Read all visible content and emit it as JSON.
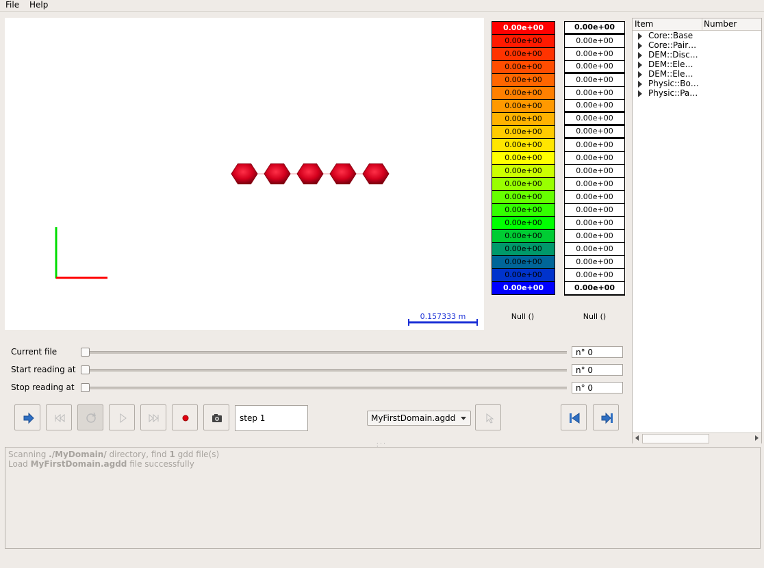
{
  "menubar": {
    "file": "File",
    "help": "Help"
  },
  "viewport": {
    "scale_label": "0.157333 m",
    "particle_color": "#d4001d",
    "axis_x_color": "#ff0000",
    "axis_y_color": "#00dd00",
    "scale_bar_color": "#1a2fd6"
  },
  "color_scale_left": {
    "cells": [
      {
        "label": "0.00e+00",
        "color": "#ff0000"
      },
      {
        "label": "0.00e+00",
        "color": "#ff1a00"
      },
      {
        "label": "0.00e+00",
        "color": "#ff3300"
      },
      {
        "label": "0.00e+00",
        "color": "#ff4d00"
      },
      {
        "label": "0.00e+00",
        "color": "#ff6600"
      },
      {
        "label": "0.00e+00",
        "color": "#ff8000"
      },
      {
        "label": "0.00e+00",
        "color": "#ff9900"
      },
      {
        "label": "0.00e+00",
        "color": "#ffb300"
      },
      {
        "label": "0.00e+00",
        "color": "#ffcc00"
      },
      {
        "label": "0.00e+00",
        "color": "#ffe600"
      },
      {
        "label": "0.00e+00",
        "color": "#ffff00"
      },
      {
        "label": "0.00e+00",
        "color": "#ccff00"
      },
      {
        "label": "0.00e+00",
        "color": "#99ff00"
      },
      {
        "label": "0.00e+00",
        "color": "#66ff00"
      },
      {
        "label": "0.00e+00",
        "color": "#33ff00"
      },
      {
        "label": "0.00e+00",
        "color": "#00ff00"
      },
      {
        "label": "0.00e+00",
        "color": "#00cc33"
      },
      {
        "label": "0.00e+00",
        "color": "#00996a"
      },
      {
        "label": "0.00e+00",
        "color": "#006699"
      },
      {
        "label": "0.00e+00",
        "color": "#0033cc"
      },
      {
        "label": "0.00e+00",
        "color": "#0000ff"
      }
    ],
    "footer": "Null ()"
  },
  "color_scale_right": {
    "cells": [
      "0.00e+00",
      "0.00e+00",
      "0.00e+00",
      "0.00e+00",
      "0.00e+00",
      "0.00e+00",
      "0.00e+00",
      "0.00e+00",
      "0.00e+00",
      "0.00e+00",
      "0.00e+00",
      "0.00e+00",
      "0.00e+00",
      "0.00e+00",
      "0.00e+00",
      "0.00e+00",
      "0.00e+00",
      "0.00e+00",
      "0.00e+00",
      "0.00e+00",
      "0.00e+00"
    ],
    "footer": "Null ()"
  },
  "tree": {
    "columns": [
      "Item",
      "Number"
    ],
    "items": [
      "Core::Base",
      "Core::Pair…",
      "DEM::Disc…",
      "DEM::Ele…",
      "DEM::Ele…",
      "Physic::Bo…",
      "Physic::Pa…"
    ]
  },
  "sliders": {
    "current_file": {
      "label": "Current file",
      "value": "n° 0"
    },
    "start_reading": {
      "label": "Start reading at",
      "value": "n° 0"
    },
    "stop_reading": {
      "label": "Stop reading at",
      "value": "n° 0"
    }
  },
  "toolbar": {
    "step": "step 1",
    "domain_selected": "MyFirstDomain.agdd"
  },
  "log": {
    "line1_prefix": "Scanning ",
    "line1_dir": "./MyDomain/",
    "line1_mid": " directory, find ",
    "line1_count": "1",
    "line1_suffix": " gdd file(s)",
    "line2_prefix": "Load ",
    "line2_file": "MyFirstDomain.agdd",
    "line2_suffix": " file successfully"
  }
}
